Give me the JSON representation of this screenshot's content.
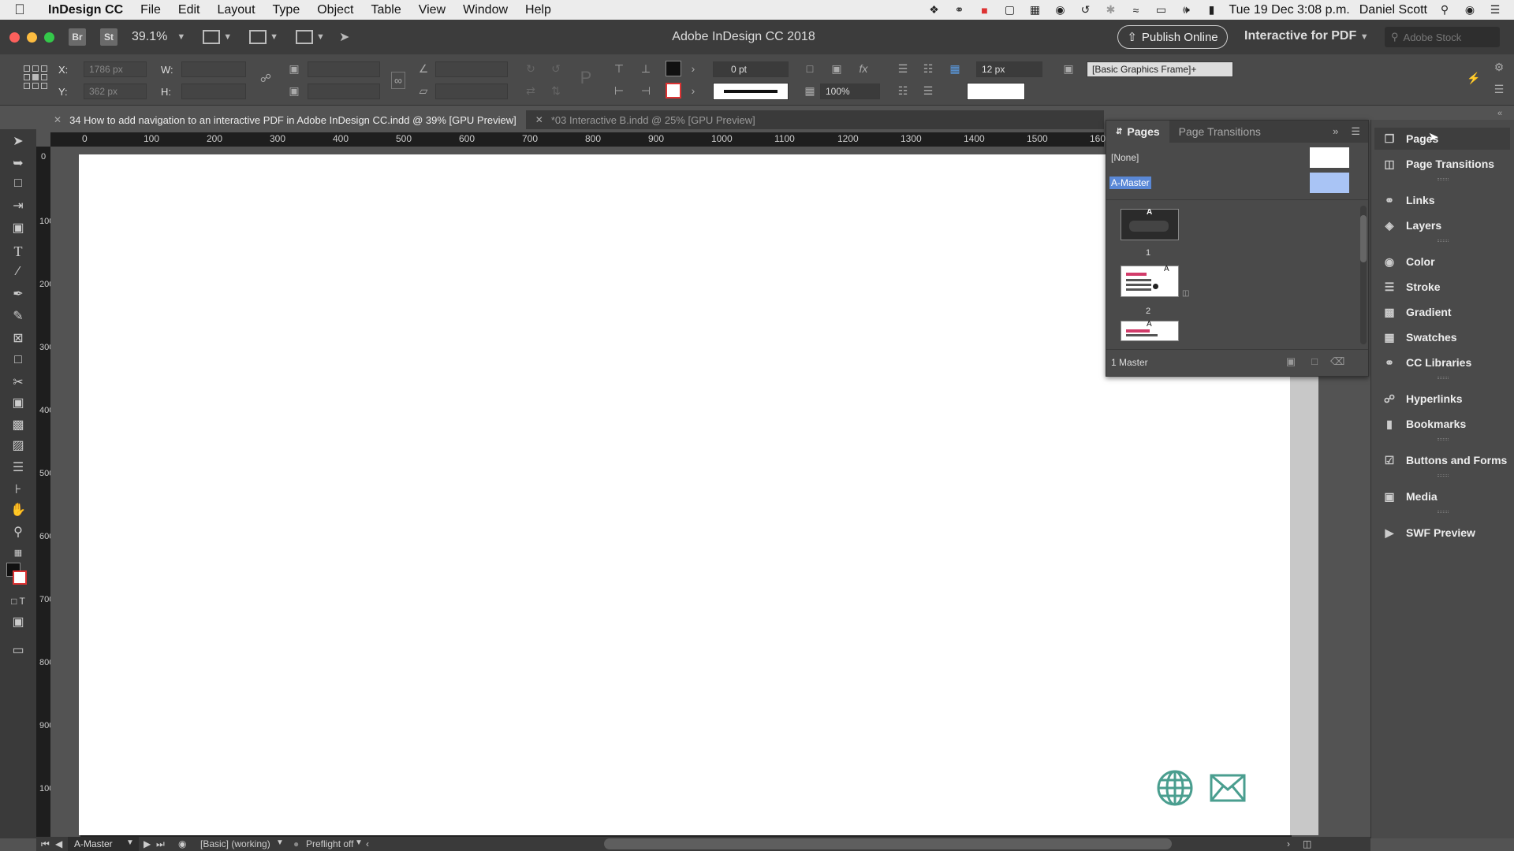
{
  "menubar": {
    "app_name": "InDesign CC",
    "items": [
      "File",
      "Edit",
      "Layout",
      "Type",
      "Object",
      "Table",
      "View",
      "Window",
      "Help"
    ],
    "clock": "Tue 19 Dec  3:08 p.m.",
    "user": "Daniel Scott"
  },
  "appbar": {
    "bridge": "Br",
    "stock": "St",
    "zoom": "39.1%",
    "title": "Adobe InDesign CC 2018",
    "publish_label": "Publish Online",
    "workspace": "Interactive for PDF",
    "search_placeholder": "Adobe Stock"
  },
  "control": {
    "x_label": "X:",
    "x_value": "1786 px",
    "y_label": "Y:",
    "y_value": "362 px",
    "w_label": "W:",
    "h_label": "H:",
    "stroke_weight": "0 pt",
    "opacity": "100%",
    "size": "12 px",
    "object_style": "[Basic Graphics Frame]+"
  },
  "tabs": [
    {
      "close": "✕",
      "label": "34 How to add navigation to an interactive PDF in Adobe InDesign CC.indd @ 39% [GPU Preview]",
      "active": true
    },
    {
      "close": "✕",
      "label": "*03 Interactive B.indd @ 25% [GPU Preview]",
      "active": false
    }
  ],
  "ruler": {
    "h_labels": [
      "0",
      "100",
      "200",
      "300",
      "400",
      "500",
      "600",
      "700",
      "800",
      "900",
      "1000",
      "1100",
      "1200",
      "1300",
      "1400",
      "1500",
      "160"
    ],
    "v_labels": [
      "0",
      "100",
      "200",
      "300",
      "400",
      "500",
      "600",
      "700",
      "800",
      "900",
      "1000"
    ]
  },
  "pages_panel": {
    "tab_pages": "Pages",
    "tab_transitions": "Page Transitions",
    "none_label": "[None]",
    "master_label": "A-Master",
    "pages": [
      {
        "num": "1",
        "master_letter": "A"
      },
      {
        "num": "2",
        "master_letter": "A"
      },
      {
        "num": "",
        "master_letter": "A"
      }
    ],
    "status": "1 Master"
  },
  "dock": {
    "items": [
      "Pages",
      "Page Transitions",
      "Links",
      "Layers",
      "Color",
      "Stroke",
      "Gradient",
      "Swatches",
      "CC Libraries",
      "Hyperlinks",
      "Bookmarks",
      "Buttons and Forms",
      "Media",
      "SWF Preview"
    ]
  },
  "statusbar": {
    "page": "A-Master",
    "style": "[Basic] (working)",
    "preflight": "Preflight off"
  },
  "colors": {
    "accent_teal": "#4a9e8f",
    "selection_blue": "#5a88d6",
    "panel_bg": "#4a4a4a"
  }
}
